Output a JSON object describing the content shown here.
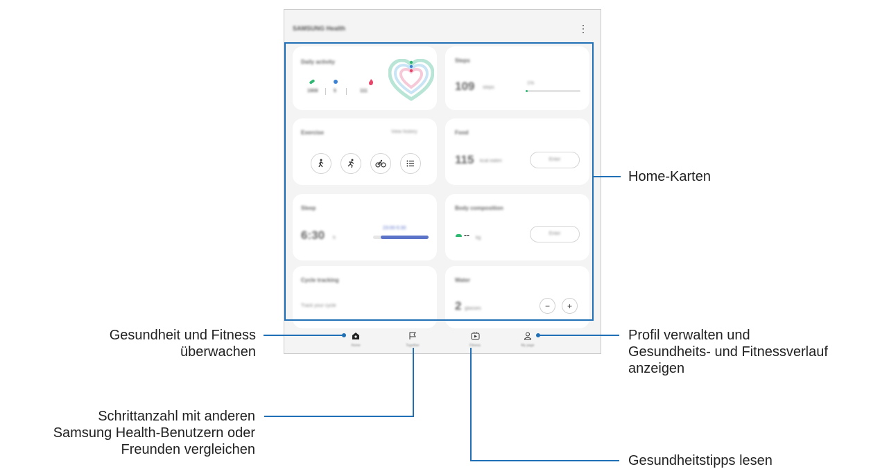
{
  "app": {
    "title": "SAMSUNG Health"
  },
  "cards": {
    "daily_activity": {
      "title": "Daily activity",
      "steps": "1908",
      "minutes": "5",
      "kcal": "111"
    },
    "steps": {
      "title": "Steps",
      "value": "109",
      "unit": "steps",
      "goal_pct": "1%",
      "progress": 0.01
    },
    "exercise": {
      "title": "Exercise",
      "link": "View history"
    },
    "food": {
      "title": "Food",
      "value": "115",
      "unit": "kcal eaten",
      "button": "Enter"
    },
    "sleep": {
      "title": "Sleep",
      "value": "6:30",
      "unit": "h",
      "times": "23:00-5:30"
    },
    "body_composition": {
      "title": "Body composition",
      "value": "--",
      "unit": "kg",
      "button": "Enter"
    },
    "cycle": {
      "title": "Cycle tracking",
      "subtitle": "Track your cycle"
    },
    "water": {
      "title": "Water",
      "value": "2",
      "unit": "glasses"
    }
  },
  "nav": [
    {
      "label": "Home",
      "icon": "home-icon",
      "active": true
    },
    {
      "label": "Together",
      "icon": "flag-icon",
      "active": false
    },
    {
      "label": "Fitness",
      "icon": "fitness-play-icon",
      "active": false
    },
    {
      "label": "My page",
      "icon": "person-icon",
      "active": false
    }
  ],
  "callouts": {
    "home_cards": "Home-Karten",
    "monitor_1": "Gesundheit und Fitness",
    "monitor_2": "überwachen",
    "profile_1": "Profil verwalten und",
    "profile_2": "Gesundheits- und Fitnessverlauf",
    "profile_3": "anzeigen",
    "compare_1": "Schrittanzahl mit anderen",
    "compare_2": "Samsung Health-Benutzern oder",
    "compare_3": "Freunden vergleichen",
    "tips": "Gesundheitstipps lesen"
  },
  "colors": {
    "callout_line": "#1e6fb5",
    "steps_green": "#2eb872",
    "sleep_blue": "#5b74c8"
  }
}
